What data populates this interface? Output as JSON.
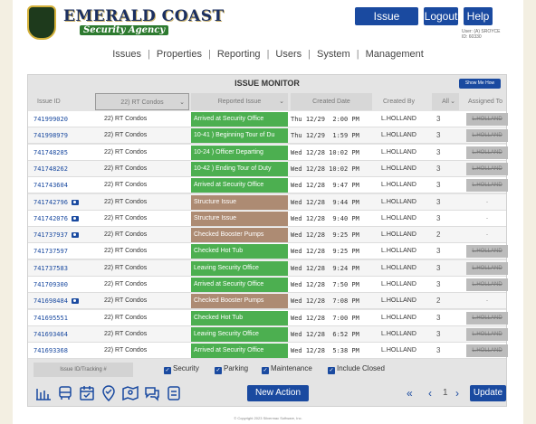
{
  "brand": {
    "title": "EMERALD COAST",
    "subtitle": "Security Agency"
  },
  "top_buttons": {
    "issue_monitor": "Issue Monitor",
    "logout": "Logout",
    "help": "Help"
  },
  "user": {
    "name": "User: (A) SROYCE",
    "id": "ID: 60330"
  },
  "nav": [
    "Issues",
    "Properties",
    "Reporting",
    "Users",
    "System",
    "Management"
  ],
  "panel": {
    "title": "ISSUE MONITOR",
    "show_me": "Show Me How"
  },
  "columns": {
    "issue_id": "Issue ID",
    "property_filter": "22) RT Condos",
    "reported_issue": "Reported Issue",
    "created_date": "Created Date",
    "created_by": "Created By",
    "all_filter": "All",
    "assigned_to": "Assigned To"
  },
  "issue_colors": {
    "green": "#4caf50",
    "brown": "#ad8b73"
  },
  "rows": [
    {
      "id": "741999020",
      "cam": false,
      "property": "22) RT Condos",
      "issue": "Arrived at Security Office",
      "color": "green",
      "date": "Thu 12/29  2:00 PM",
      "by": "L.HOLLAND",
      "all": "3",
      "assigned": "L.HOLLAND"
    },
    {
      "id": "741998979",
      "cam": false,
      "property": "22) RT Condos",
      "issue": "10-41 ) Beginning Tour of Du",
      "color": "green",
      "date": "Thu 12/29  1:59 PM",
      "by": "L.HOLLAND",
      "all": "3",
      "assigned": "L.HOLLAND"
    },
    {
      "id": "741748285",
      "cam": false,
      "property": "22) RT Condos",
      "issue": "10-24 ) Officer Departing",
      "color": "green",
      "date": "Wed 12/28 10:02 PM",
      "by": "L.HOLLAND",
      "all": "3",
      "assigned": "L.HOLLAND"
    },
    {
      "id": "741748262",
      "cam": false,
      "property": "22) RT Condos",
      "issue": "10-42 ) Ending Tour of Duty",
      "color": "green",
      "date": "Wed 12/28 10:02 PM",
      "by": "L.HOLLAND",
      "all": "3",
      "assigned": "L.HOLLAND"
    },
    {
      "id": "741743604",
      "cam": false,
      "property": "22) RT Condos",
      "issue": "Arrived at Security Office",
      "color": "green",
      "date": "Wed 12/28  9:47 PM",
      "by": "L.HOLLAND",
      "all": "3",
      "assigned": "L.HOLLAND"
    },
    {
      "id": "741742796",
      "cam": true,
      "property": "22) RT Condos",
      "issue": "Structure Issue",
      "color": "brown",
      "date": "Wed 12/28  9:44 PM",
      "by": "L.HOLLAND",
      "all": "3",
      "assigned": "-"
    },
    {
      "id": "741742076",
      "cam": true,
      "property": "22) RT Condos",
      "issue": "Structure Issue",
      "color": "brown",
      "date": "Wed 12/28  9:40 PM",
      "by": "L.HOLLAND",
      "all": "3",
      "assigned": "-"
    },
    {
      "id": "741737937",
      "cam": true,
      "property": "22) RT Condos",
      "issue": "Checked Booster Pumps",
      "color": "brown",
      "date": "Wed 12/28  9:25 PM",
      "by": "L.HOLLAND",
      "all": "2",
      "assigned": "-"
    },
    {
      "id": "741737597",
      "cam": false,
      "property": "22) RT Condos",
      "issue": "Checked Hot Tub",
      "color": "green",
      "date": "Wed 12/28  9:25 PM",
      "by": "L.HOLLAND",
      "all": "3",
      "assigned": "L.HOLLAND"
    },
    {
      "id": "741737583",
      "cam": false,
      "property": "22) RT Condos",
      "issue": "Leaving Security Office",
      "color": "green",
      "date": "Wed 12/28  9:24 PM",
      "by": "L.HOLLAND",
      "all": "3",
      "assigned": "L.HOLLAND"
    },
    {
      "id": "741709300",
      "cam": false,
      "property": "22) RT Condos",
      "issue": "Arrived at Security Office",
      "color": "green",
      "date": "Wed 12/28  7:50 PM",
      "by": "L.HOLLAND",
      "all": "3",
      "assigned": "L.HOLLAND"
    },
    {
      "id": "741698484",
      "cam": true,
      "property": "22) RT Condos",
      "issue": "Checked Booster Pumps",
      "color": "brown",
      "date": "Wed 12/28  7:08 PM",
      "by": "L.HOLLAND",
      "all": "2",
      "assigned": "-"
    },
    {
      "id": "741695551",
      "cam": false,
      "property": "22) RT Condos",
      "issue": "Checked Hot Tub",
      "color": "green",
      "date": "Wed 12/28  7:00 PM",
      "by": "L.HOLLAND",
      "all": "3",
      "assigned": "L.HOLLAND"
    },
    {
      "id": "741693464",
      "cam": false,
      "property": "22) RT Condos",
      "issue": "Leaving Security Office",
      "color": "green",
      "date": "Wed 12/28  6:52 PM",
      "by": "L.HOLLAND",
      "all": "3",
      "assigned": "L.HOLLAND"
    },
    {
      "id": "741693368",
      "cam": false,
      "property": "22) RT Condos",
      "issue": "Arrived at Security Office",
      "color": "green",
      "date": "Wed 12/28  5:38 PM",
      "by": "L.HOLLAND",
      "all": "3",
      "assigned": "L.HOLLAND"
    }
  ],
  "filters": {
    "tracking_placeholder": "Issue ID/Tracking #",
    "security": "Security",
    "parking": "Parking",
    "maintenance": "Maintenance",
    "include_closed": "Include Closed"
  },
  "toolbar": {
    "icons": [
      "bar-chart-icon",
      "bus-icon",
      "calendar-icon",
      "location-check-icon",
      "map-pin-icon",
      "chat-icon",
      "notes-icon"
    ],
    "new_action": "New Action",
    "first_page": "«",
    "prev_page": "‹",
    "page": "1",
    "next_page": "›",
    "update": "Update"
  },
  "copyright": "© Copyright 2023 Silvermac Software, Inc."
}
